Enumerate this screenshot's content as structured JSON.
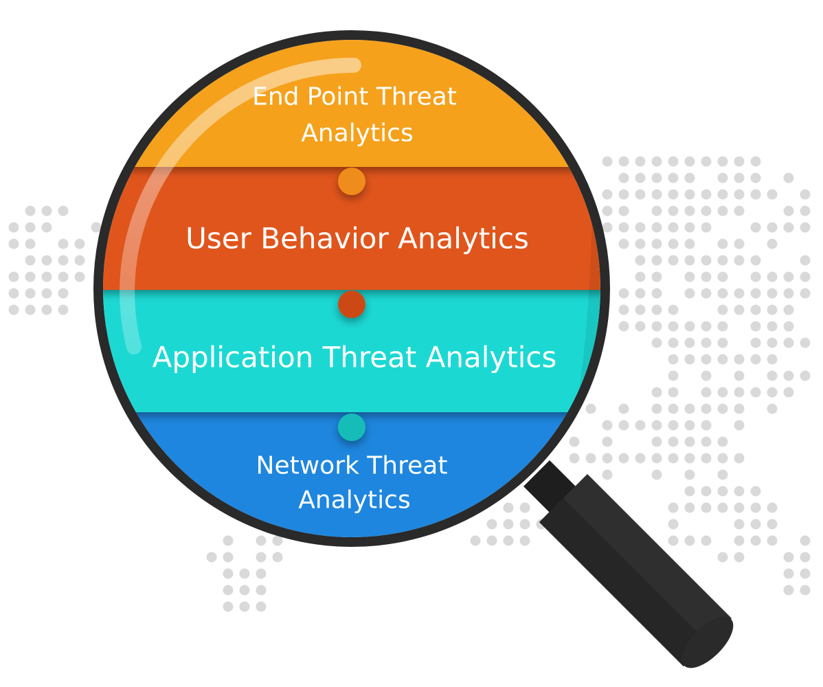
{
  "diagram": {
    "bands": [
      {
        "id": "endpoint",
        "lines": [
          "End Point Threat",
          "Analytics"
        ],
        "color": "#f5a11f",
        "color_dark": "#ef8d1a"
      },
      {
        "id": "user",
        "lines": [
          "User Behavior Analytics"
        ],
        "color": "#e0551c",
        "color_dark": "#cc4a14"
      },
      {
        "id": "application",
        "lines": [
          "Application Threat Analytics"
        ],
        "color": "#1ad8d3",
        "color_dark": "#12bdb8"
      },
      {
        "id": "network",
        "lines": [
          "Network Threat",
          "Analytics"
        ],
        "color": "#1e86de",
        "color_dark": "#1562b8"
      }
    ],
    "colors": {
      "lens_rim": "#2a2a2a",
      "handle": "#2f2f2f",
      "map_dots": "#d9d9d9"
    },
    "icons": [
      "magnifying-glass-icon",
      "world-map-dots"
    ]
  }
}
